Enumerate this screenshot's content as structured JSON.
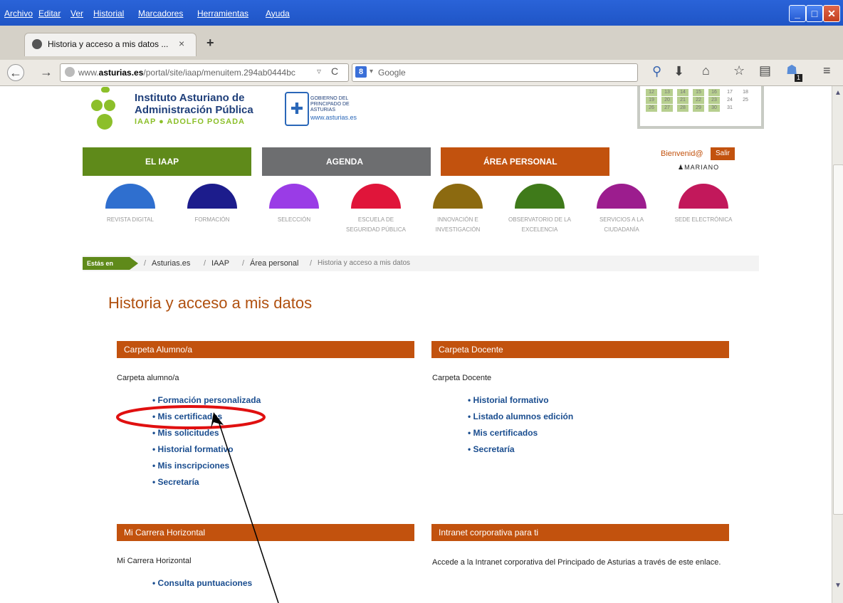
{
  "menu": [
    "Archivo",
    "Editar",
    "Ver",
    "Historial",
    "Marcadores",
    "Herramientas",
    "Ayuda"
  ],
  "tab": {
    "title": "Historia y acceso a mis datos ...",
    "close": "×",
    "new": "+"
  },
  "url": {
    "prefix": "www.",
    "domain": "asturias.es",
    "rest": "/portal/site/iaap/menuitem.294ab0444bc"
  },
  "search": {
    "placeholder": "Google"
  },
  "badge": "1",
  "logo": {
    "line1": "Instituto Asturiano de",
    "line2": "Administración Pública",
    "line3": "IAAP ● ADOLFO POSADA"
  },
  "gov": {
    "l1": "GOBIERNO DEL",
    "l2": "PRINCIPADO DE",
    "l3": "ASTURIAS",
    "web": "www.asturias.es"
  },
  "calendar": [
    [
      "12",
      "13",
      "14",
      "15",
      "16",
      "17",
      "18"
    ],
    [
      "19",
      "20",
      "21",
      "22",
      "23",
      "24",
      "25"
    ],
    [
      "26",
      "27",
      "28",
      "29",
      "30",
      "31",
      ""
    ]
  ],
  "nav": {
    "b1": "EL IAAP",
    "b2": "AGENDA",
    "b3": "ÁREA PERSONAL",
    "welcome": "Bienvenid@",
    "logout": "Salir",
    "user": "MARIANO",
    "colors": {
      "b1": "#5f8a1a",
      "b2": "#6d6e70",
      "b3": "#c2520e"
    }
  },
  "icons": [
    {
      "label": "REVISTA DIGITAL",
      "color": "#2f6fcf"
    },
    {
      "label": "FORMACIÓN",
      "color": "#1c1c8c"
    },
    {
      "label": "SELECCIÓN",
      "color": "#9a3ce6"
    },
    {
      "label": "ESCUELA DE SEGURIDAD PÚBLICA",
      "color": "#e0153a"
    },
    {
      "label": "INNOVACIÓN E INVESTIGACIÓN",
      "color": "#8c6a10"
    },
    {
      "label": "OBSERVATORIO DE LA EXCELENCIA",
      "color": "#3f7a1a"
    },
    {
      "label": "SERVICIOS A LA CIUDADANÍA",
      "color": "#9c1d8e"
    },
    {
      "label": "SEDE ELECTRÓNICA",
      "color": "#c2185b"
    }
  ],
  "breadcrumb": {
    "tag": "Estás en",
    "items": [
      "Asturias.es",
      "IAAP",
      "Área personal",
      "Historia y acceso a mis datos"
    ]
  },
  "page_title": "Historia y acceso a mis datos",
  "alumno": {
    "head": "Carpeta Alumno/a",
    "intro": "Carpeta alumno/a",
    "links": [
      "Formación personalizada",
      "Mis certificados",
      "Mis solicitudes",
      "Historial formativo",
      "Mis inscripciones",
      "Secretaría"
    ]
  },
  "docente": {
    "head": "Carpeta Docente",
    "intro": "Carpeta Docente",
    "links": [
      "Historial formativo",
      "Listado alumnos edición",
      "Mis certificados",
      "Secretaría"
    ]
  },
  "carrera": {
    "head": "Mi Carrera Horizontal",
    "intro": "Mi Carrera Horizontal",
    "links": [
      "Consulta puntuaciones"
    ]
  },
  "intranet": {
    "head": "Intranet corporativa para ti",
    "text": "Accede a la Intranet corporativa del Principado de Asturias a través de este enlace."
  }
}
